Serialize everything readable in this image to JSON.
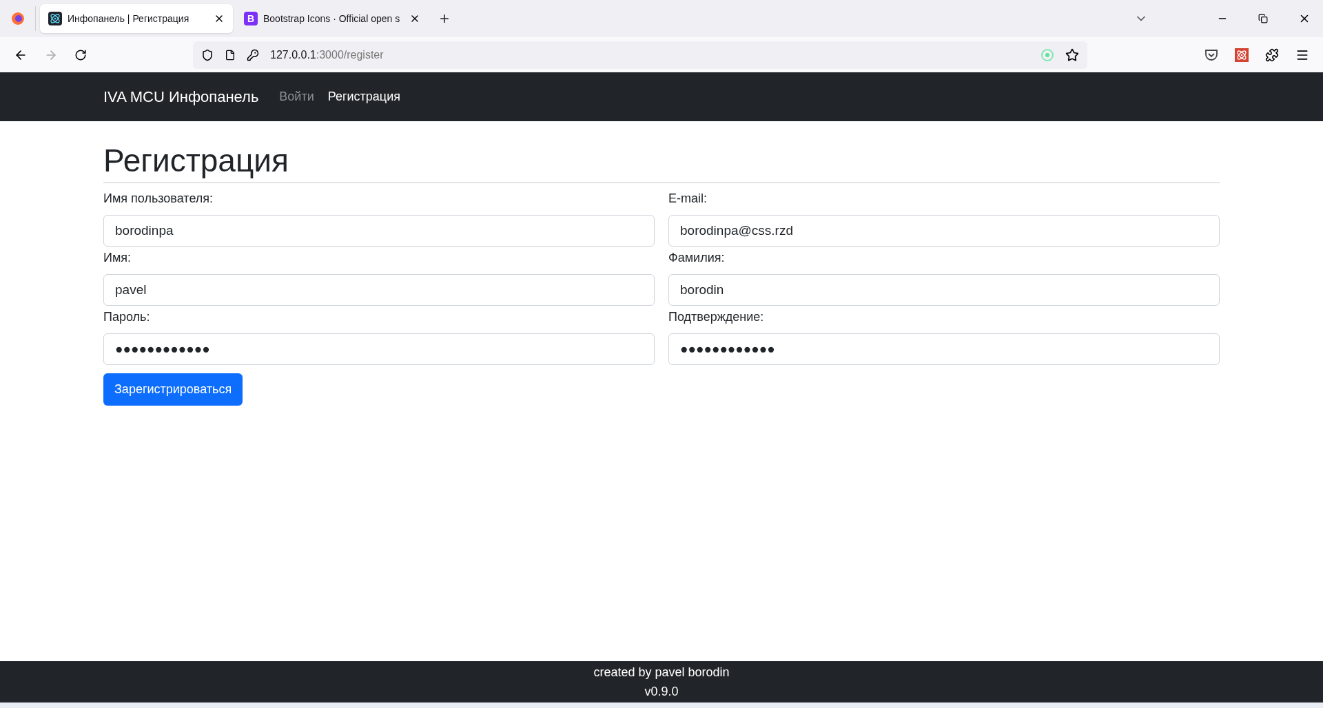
{
  "browser": {
    "tabs": [
      {
        "title": "Инфопанель | Регистрация",
        "selected": true,
        "kind": "react"
      },
      {
        "title": "Bootstrap Icons · Official open s",
        "selected": false,
        "kind": "bootstrap"
      }
    ],
    "tab_favicon_letter": "B",
    "new_tab": "+",
    "url_host": "127.0.0.1",
    "url_path": ":3000/register"
  },
  "navbar": {
    "brand": "IVA MCU Инфопанель",
    "links": [
      {
        "label": "Войти",
        "selected": false
      },
      {
        "label": "Регистрация",
        "selected": true
      }
    ]
  },
  "page": {
    "heading": "Регистрация",
    "fields": [
      {
        "label": "Имя пользователя:",
        "value": "borodinpa"
      },
      {
        "label": "E-mail:",
        "value": "borodinpa@css.rzd"
      },
      {
        "label": "Имя:",
        "value": "pavel"
      },
      {
        "label": "Фамилия:",
        "value": "borodin"
      },
      {
        "label": "Пароль:",
        "value": "●●●●●●●●●●●●"
      },
      {
        "label": "Подтверждение:",
        "value": "●●●●●●●●●●●●"
      }
    ],
    "submit": "Зарегистрироваться"
  },
  "footer": {
    "lines": [
      "created by pavel borodin",
      "v0.9.0"
    ]
  }
}
